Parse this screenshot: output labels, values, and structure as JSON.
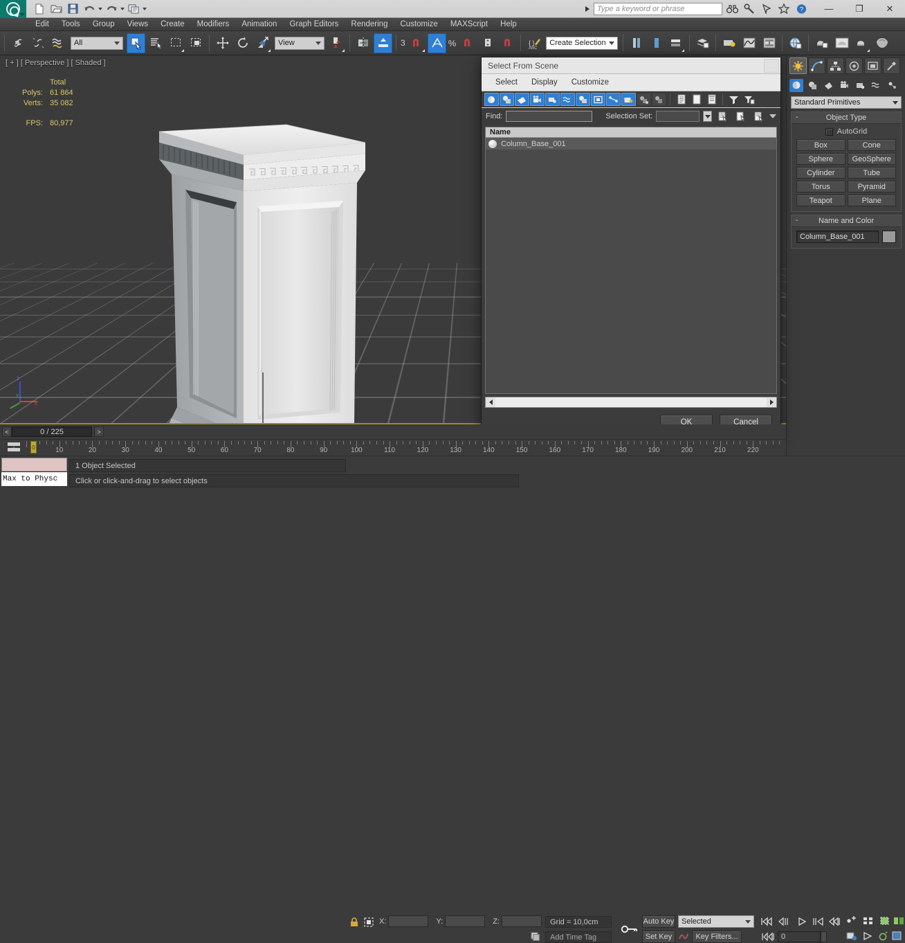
{
  "titlebar": {
    "quick_access": [
      {
        "name": "new-file-icon",
        "label": "New"
      },
      {
        "name": "open-file-icon",
        "label": "Open"
      },
      {
        "name": "save-file-icon",
        "label": "Save"
      },
      {
        "name": "undo-icon",
        "label": "Undo"
      },
      {
        "name": "redo-icon",
        "label": "Redo"
      },
      {
        "name": "project-folder-icon",
        "label": "Set Project Folder"
      }
    ],
    "search_placeholder": "Type a keyword or phrase",
    "icons": [
      "binoculars-icon",
      "wrench-icon",
      "pin-icon",
      "star-icon",
      "help-icon"
    ],
    "window_buttons": {
      "minimize": "—",
      "maximize": "❐",
      "close": "✕"
    }
  },
  "menubar": {
    "items": [
      "Edit",
      "Tools",
      "Group",
      "Views",
      "Create",
      "Modifiers",
      "Animation",
      "Graph Editors",
      "Rendering",
      "Customize",
      "MAXScript",
      "Help"
    ]
  },
  "toolbar": {
    "selection_filter": "All",
    "reference_coord": "View",
    "named_selection_set": "Create Selection Se",
    "angle_snap_value": "3",
    "percent_label": "%"
  },
  "viewport": {
    "label": "[ + ] [ Perspective ] [ Shaded ]",
    "stats": {
      "header": "Total",
      "polys_label": "Polys:",
      "polys_value": "61 864",
      "verts_label": "Verts:",
      "verts_value": "35 082",
      "fps_label": "FPS:",
      "fps_value": "80,977"
    },
    "axis": {
      "x": "x",
      "y": "y",
      "z": "z"
    },
    "object_axis_label": "z",
    "object_axis_label_x": "x"
  },
  "dialog": {
    "title": "Select From Scene",
    "menu": [
      "Select",
      "Display",
      "Customize"
    ],
    "filters": [
      "geometry-filter-icon",
      "shapes-filter-icon",
      "lights-filter-icon",
      "cameras-filter-icon",
      "helpers-filter-icon",
      "space-warps-filter-icon",
      "groups-filter-icon",
      "xrefs-filter-icon",
      "bones-filter-icon",
      "containers-filter-icon",
      "selection-sets-icon",
      "all-none-icon"
    ],
    "find_label": "Find:",
    "find_value": "",
    "selection_set_label": "Selection Set:",
    "selection_set_value": "",
    "list_header": "Name",
    "list_items": [
      {
        "name": "Column_Base_001",
        "selected": true
      }
    ],
    "ok_label": "OK",
    "cancel_label": "Cancel"
  },
  "command_panel": {
    "tabs": [
      "create-tab",
      "modify-tab",
      "hierarchy-tab",
      "motion-tab",
      "display-tab",
      "utilities-tab"
    ],
    "subtabs": [
      "geometry-icon",
      "shapes-icon",
      "lights-icon",
      "cameras-icon",
      "helpers-icon",
      "space-warps-icon",
      "systems-icon"
    ],
    "category": "Standard Primitives",
    "object_type": {
      "title": "Object Type",
      "autogrid_label": "AutoGrid",
      "buttons": [
        "Box",
        "Cone",
        "Sphere",
        "GeoSphere",
        "Cylinder",
        "Tube",
        "Torus",
        "Pyramid",
        "Teapot",
        "Plane"
      ]
    },
    "name_and_color": {
      "title": "Name and Color",
      "name_value": "Column_Base_001",
      "color_hex": "#9a9a9a"
    }
  },
  "timeline": {
    "current_frame_display": "0 / 225",
    "prev_label": "<",
    "next_label": ">",
    "ticks": [
      "10",
      "20",
      "30",
      "40",
      "50",
      "60",
      "70",
      "80",
      "90",
      "100",
      "110",
      "120",
      "130",
      "140",
      "150",
      "160",
      "170",
      "180",
      "190",
      "200",
      "210",
      "220"
    ],
    "handle_label": "0"
  },
  "status": {
    "maxscript_listener": "Max to Physc",
    "selection_status": "1 Object Selected",
    "prompt": "Click or click-and-drag to select objects",
    "coords": {
      "x_label": "X:",
      "x_value": "",
      "y_label": "Y:",
      "y_value": "",
      "z_label": "Z:",
      "z_value": ""
    },
    "grid_label": "Grid = 10,0cm",
    "add_time_tag": "Add Time Tag"
  },
  "animation": {
    "auto_key": "Auto Key",
    "set_key": "Set Key",
    "key_mode": "Selected",
    "key_filters": "Key Filters...",
    "frame_value": "0",
    "playback_icons": [
      "go-to-start-icon",
      "prev-frame-icon",
      "play-icon",
      "next-frame-icon",
      "go-to-end-icon"
    ]
  },
  "colors": {
    "accent_blue": "#2f7fd4",
    "panel_gray": "#3b3b3b",
    "stats_yellow": "#d8c56a",
    "selection_red": "#d06a6a",
    "model_white": "#e8e8e8"
  }
}
